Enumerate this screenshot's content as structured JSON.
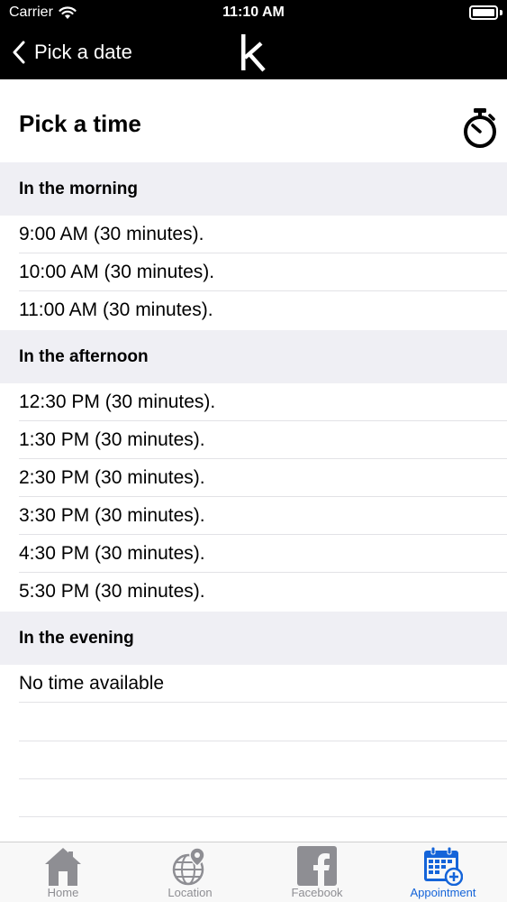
{
  "status_bar": {
    "carrier": "Carrier",
    "time": "11:10 AM"
  },
  "nav": {
    "back_label": "Pick a date",
    "logo_text": "k"
  },
  "header": {
    "title": "Pick a time",
    "icon": "stopwatch-icon"
  },
  "sections": [
    {
      "title": "In the morning",
      "slots": [
        "9:00 AM (30 minutes).",
        "10:00 AM (30 minutes).",
        "11:00 AM (30 minutes)."
      ]
    },
    {
      "title": "In the afternoon",
      "slots": [
        "12:30 PM (30 minutes).",
        "1:30 PM (30 minutes).",
        "2:30 PM (30 minutes).",
        "3:30 PM (30 minutes).",
        "4:30 PM (30 minutes).",
        "5:30 PM (30 minutes)."
      ]
    },
    {
      "title": "In the evening",
      "empty_message": "No time available"
    }
  ],
  "tab_bar": {
    "tabs": [
      {
        "label": "Home",
        "icon": "house-icon"
      },
      {
        "label": "Location",
        "icon": "globe-pin-icon"
      },
      {
        "label": "Facebook",
        "icon": "facebook-icon"
      },
      {
        "label": "Appointment",
        "icon": "calendar-add-icon",
        "active": true
      }
    ]
  },
  "colors": {
    "nav_background": "#000000",
    "section_background": "#efeff4",
    "active_tab": "#1464d9",
    "inactive_tab": "#8e8e93"
  }
}
